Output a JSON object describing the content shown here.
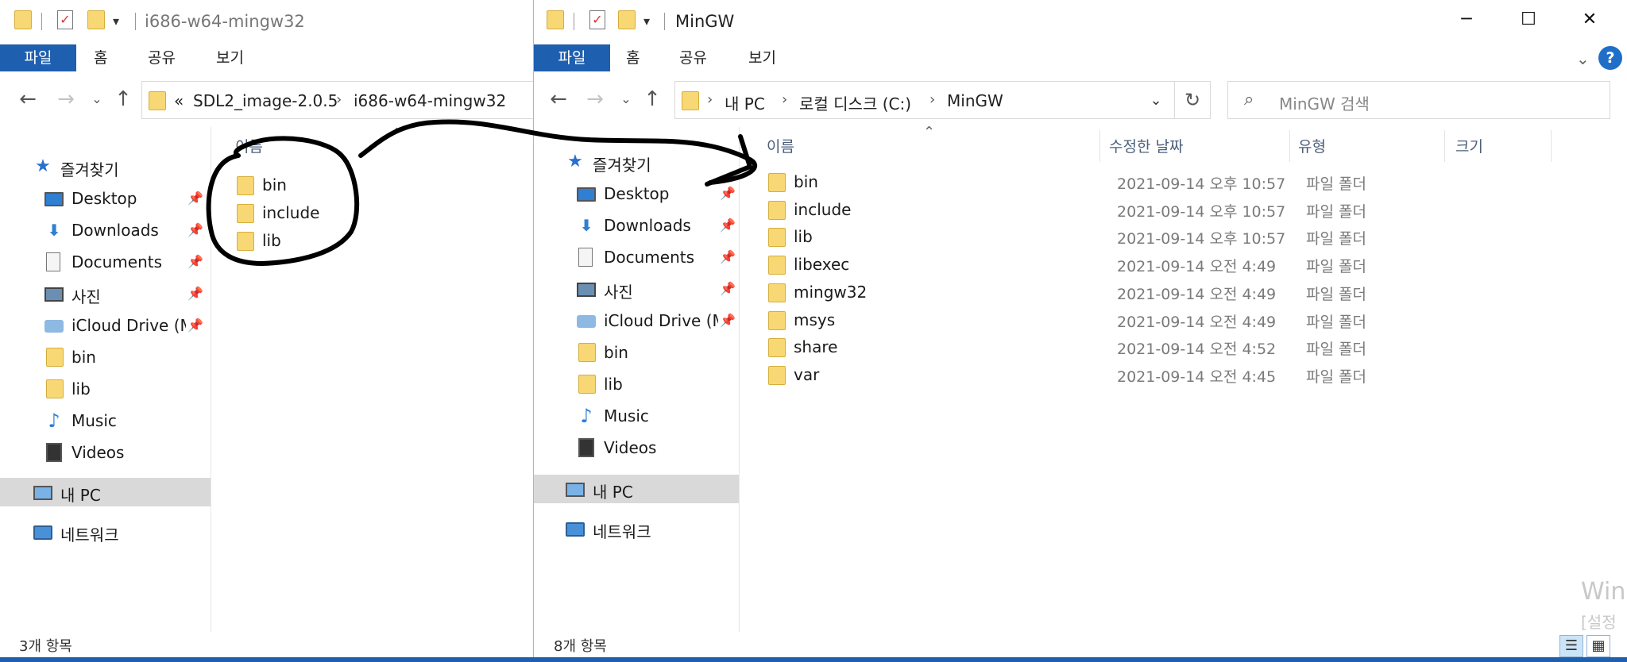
{
  "left_window": {
    "title": "i686-w64-mingw32",
    "ribbon": {
      "file": "파일",
      "home": "홈",
      "share": "공유",
      "view": "보기"
    },
    "address": {
      "overflow": "«",
      "crumbs": [
        "SDL2_image-2.0.5",
        "i686-w64-mingw32"
      ]
    },
    "nav": {
      "favorites": "즐겨찾기",
      "items": [
        "Desktop",
        "Downloads",
        "Documents",
        "사진",
        "iCloud Drive (M",
        "bin",
        "lib",
        "Music",
        "Videos"
      ],
      "pc": "내 PC",
      "network": "네트워크"
    },
    "column_name": "이름",
    "files": [
      "bin",
      "include",
      "lib"
    ],
    "status": "3개 항목"
  },
  "right_window": {
    "title": "MinGW",
    "ribbon": {
      "file": "파일",
      "home": "홈",
      "share": "공유",
      "view": "보기"
    },
    "address": {
      "crumbs": [
        "내 PC",
        "로컬 디스크 (C:)",
        "MinGW"
      ]
    },
    "search": {
      "placeholder": "MinGW 검색"
    },
    "nav": {
      "favorites": "즐겨찾기",
      "items": [
        "Desktop",
        "Downloads",
        "Documents",
        "사진",
        "iCloud Drive (M",
        "bin",
        "lib",
        "Music",
        "Videos"
      ],
      "pc": "내 PC",
      "network": "네트워크"
    },
    "columns": {
      "name": "이름",
      "modified": "수정한 날짜",
      "type": "유형",
      "size": "크기"
    },
    "files": [
      {
        "name": "bin",
        "date": "2021-09-14 오후 10:57",
        "type": "파일 폴더"
      },
      {
        "name": "include",
        "date": "2021-09-14 오후 10:57",
        "type": "파일 폴더"
      },
      {
        "name": "lib",
        "date": "2021-09-14 오후 10:57",
        "type": "파일 폴더"
      },
      {
        "name": "libexec",
        "date": "2021-09-14 오전 4:49",
        "type": "파일 폴더"
      },
      {
        "name": "mingw32",
        "date": "2021-09-14 오전 4:49",
        "type": "파일 폴더"
      },
      {
        "name": "msys",
        "date": "2021-09-14 오전 4:49",
        "type": "파일 폴더"
      },
      {
        "name": "share",
        "date": "2021-09-14 오전 4:52",
        "type": "파일 폴더"
      },
      {
        "name": "var",
        "date": "2021-09-14 오전 4:45",
        "type": "파일 폴더"
      }
    ],
    "status": "8개 항목"
  },
  "watermark": {
    "line1": "Win",
    "line2": "[설정"
  },
  "accent_color": "#1f5fb0",
  "icons": [
    "folder-icon",
    "check-icon",
    "star-icon",
    "desktop-icon",
    "download-icon",
    "documents-icon",
    "photo-icon",
    "cloud-icon",
    "music-icon",
    "video-icon",
    "pc-icon",
    "network-icon",
    "search-icon",
    "refresh-icon"
  ]
}
